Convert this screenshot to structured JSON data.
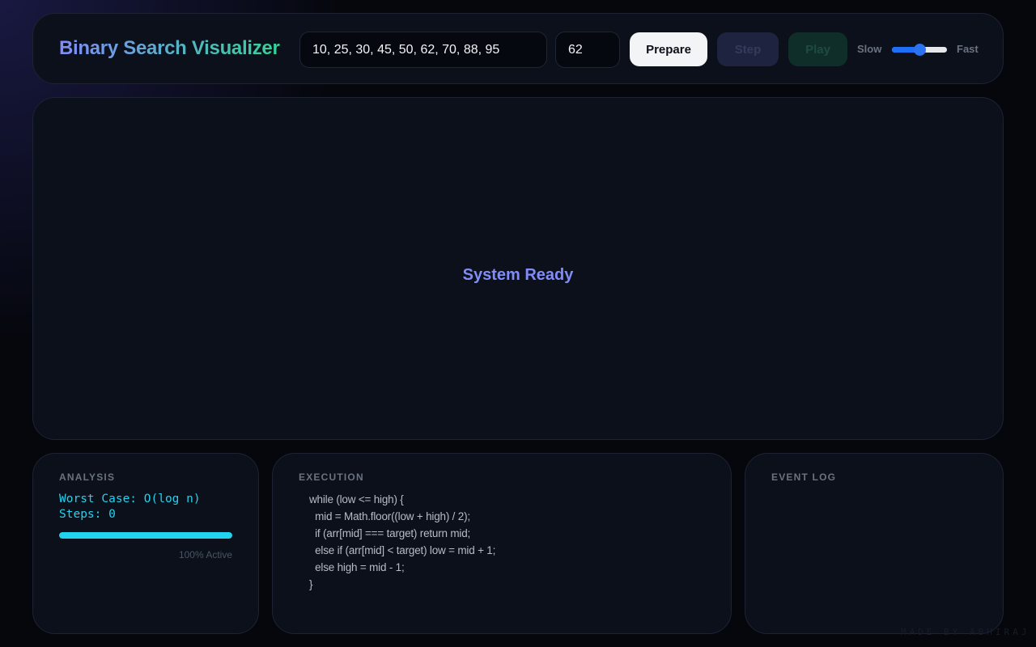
{
  "header": {
    "title": "Binary Search Visualizer",
    "array_value": "10, 25, 30, 45, 50, 62, 70, 88, 95",
    "target_value": "62",
    "prepare_label": "Prepare",
    "step_label": "Step",
    "play_label": "Play",
    "speed": {
      "slow_label": "Slow",
      "fast_label": "Fast",
      "value": 0.5
    }
  },
  "stage": {
    "status": "System Ready"
  },
  "analysis": {
    "title": "ANALYSIS",
    "worst_case": "Worst Case: O(log n)",
    "steps": "Steps: 0",
    "progress": 1.0,
    "progress_label": "100% Active"
  },
  "execution": {
    "title": "EXECUTION",
    "code_lines": [
      "while (low <= high) {",
      "  mid = Math.floor((low + high) / 2);",
      "  if (arr[mid] === target) return mid;",
      "  else if (arr[mid] < target) low = mid + 1;",
      "  else high = mid - 1;",
      "}"
    ]
  },
  "event_log": {
    "title": "EVENT LOG",
    "entries": []
  },
  "footer": {
    "credit": "MADE BY ABHIRAJ"
  },
  "colors": {
    "accent_indigo": "#818cf8",
    "accent_teal": "#34d399",
    "accent_cyan": "#22d3ee",
    "slider_blue": "#1e6ff5"
  },
  "icons": []
}
